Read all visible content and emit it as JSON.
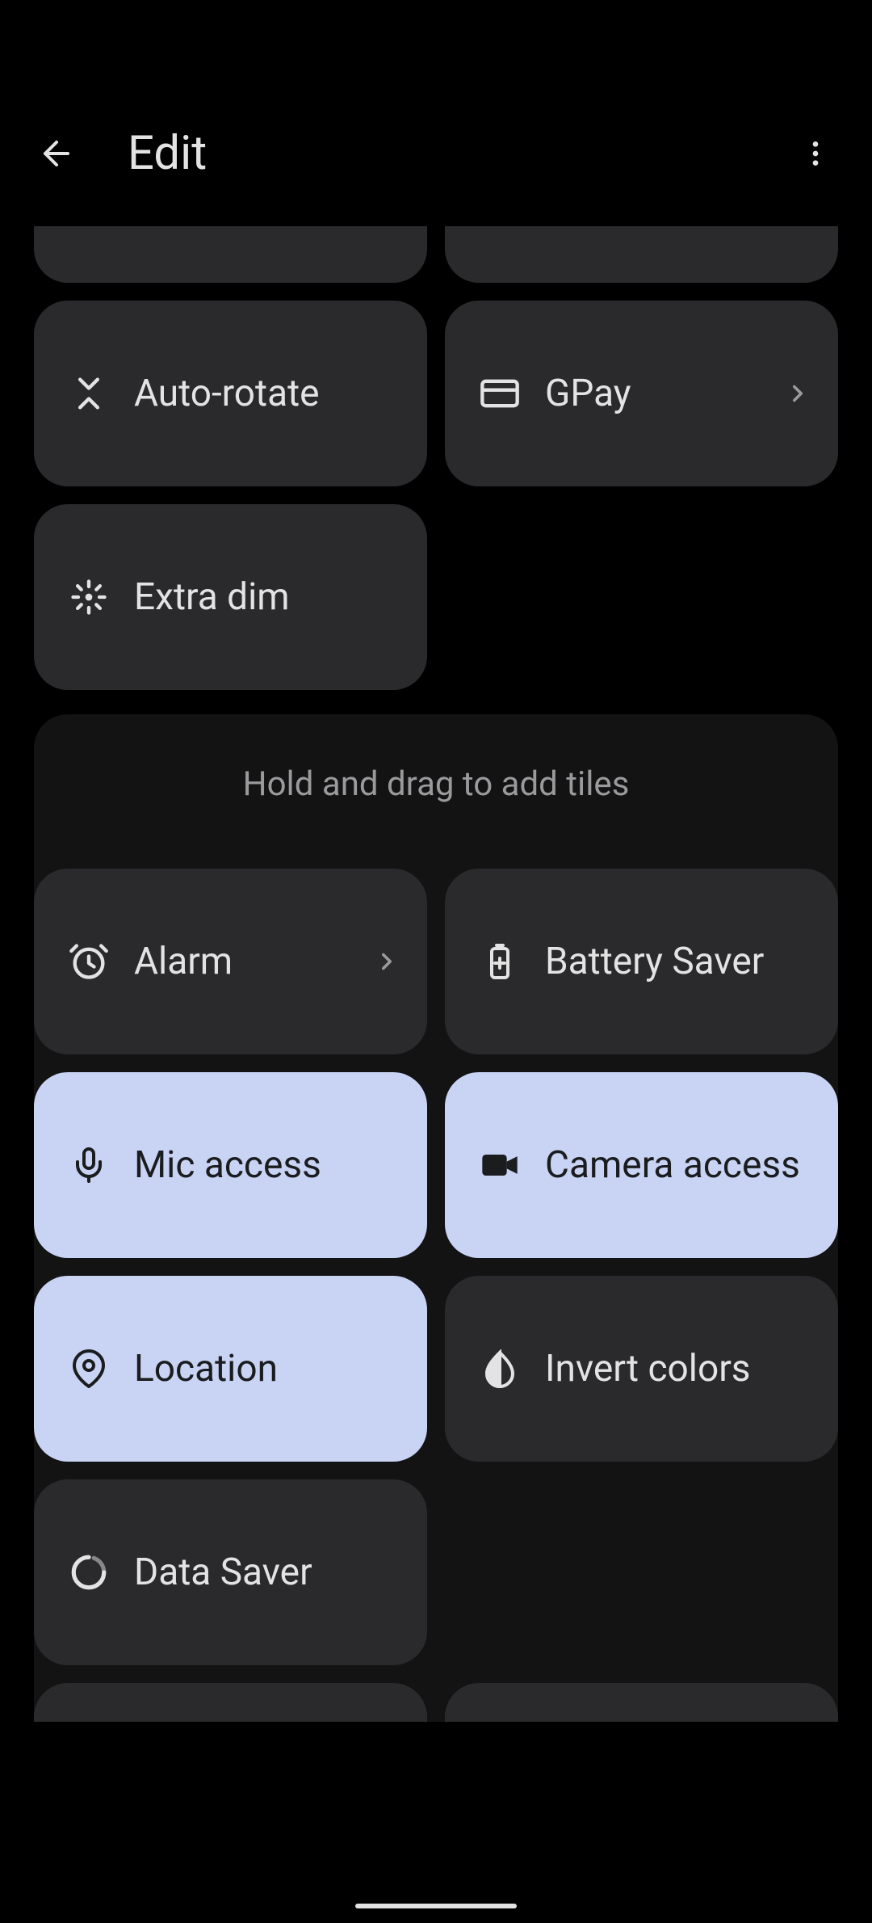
{
  "header": {
    "title": "Edit"
  },
  "active_tiles": {
    "auto_rotate": "Auto-rotate",
    "gpay": "GPay",
    "extra_dim": "Extra dim"
  },
  "section_hint": "Hold and drag to add tiles",
  "available_tiles": {
    "alarm": "Alarm",
    "battery_saver": "Battery Saver",
    "mic_access": "Mic access",
    "camera_access": "Camera access",
    "location": "Location",
    "invert_colors": "Invert colors",
    "data_saver": "Data Saver"
  },
  "colors": {
    "active_tile": "#c9d4f5",
    "inactive_tile": "#2a2a2d",
    "background": "#000000"
  }
}
